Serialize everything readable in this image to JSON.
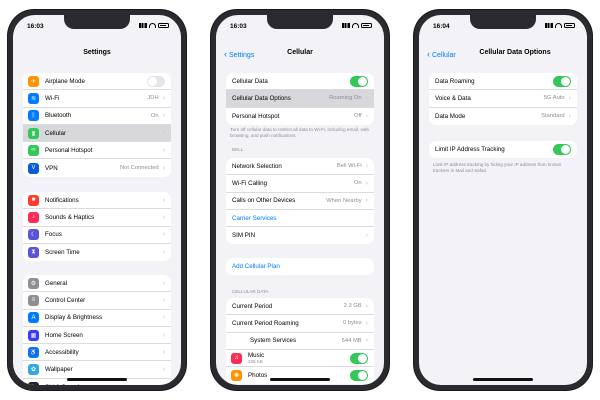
{
  "phone1": {
    "time": "16:03",
    "title": "Settings",
    "group1": [
      {
        "label": "Airplane Mode",
        "value": "",
        "icon": "airplane-icon",
        "color": "#ff9500",
        "toggle": "off"
      },
      {
        "label": "Wi-Fi",
        "value": "JDH",
        "icon": "wifi-icon",
        "color": "#007aff"
      },
      {
        "label": "Bluetooth",
        "value": "On",
        "icon": "bluetooth-icon",
        "color": "#007aff"
      },
      {
        "label": "Cellular",
        "value": "",
        "icon": "cellular-icon",
        "color": "#34c759",
        "selected": true
      },
      {
        "label": "Personal Hotspot",
        "value": "",
        "icon": "hotspot-icon",
        "color": "#34c759"
      },
      {
        "label": "VPN",
        "value": "Not Connected",
        "icon": "vpn-icon",
        "color": "#0a5bd6"
      }
    ],
    "group2": [
      {
        "label": "Notifications",
        "icon": "notifications-icon",
        "color": "#ff3b30"
      },
      {
        "label": "Sounds & Haptics",
        "icon": "sounds-icon",
        "color": "#ff2d55"
      },
      {
        "label": "Focus",
        "icon": "focus-icon",
        "color": "#5856d6"
      },
      {
        "label": "Screen Time",
        "icon": "screen-time-icon",
        "color": "#5856d6"
      }
    ],
    "group3": [
      {
        "label": "General",
        "icon": "general-icon",
        "color": "#8e8e93"
      },
      {
        "label": "Control Center",
        "icon": "control-center-icon",
        "color": "#8e8e93"
      },
      {
        "label": "Display & Brightness",
        "icon": "display-icon",
        "color": "#007aff"
      },
      {
        "label": "Home Screen",
        "icon": "home-screen-icon",
        "color": "#3a3aff"
      },
      {
        "label": "Accessibility",
        "icon": "accessibility-icon",
        "color": "#007aff"
      },
      {
        "label": "Wallpaper",
        "icon": "wallpaper-icon",
        "color": "#34aadc"
      },
      {
        "label": "Siri & Search",
        "icon": "siri-icon",
        "color": "#222222"
      }
    ]
  },
  "phone2": {
    "time": "16:03",
    "back": "Settings",
    "title": "Cellular",
    "group1": [
      {
        "label": "Cellular Data",
        "toggle": "on"
      },
      {
        "label": "Cellular Data Options",
        "value": "Roaming On",
        "selected": true
      },
      {
        "label": "Personal Hotspot",
        "value": "Off"
      }
    ],
    "note1": "Turn off cellular data to restrict all data to Wi-Fi, including email, web browsing, and push notifications.",
    "section_bell": "BELL",
    "group2": [
      {
        "label": "Network Selection",
        "value": "Bell Wi-Fi"
      },
      {
        "label": "Wi-Fi Calling",
        "value": "On"
      },
      {
        "label": "Calls on Other Devices",
        "value": "When Nearby"
      },
      {
        "label": "Carrier Services",
        "blue": true
      },
      {
        "label": "SIM PIN"
      }
    ],
    "add_plan": "Add Cellular Plan",
    "section_data": "CELLULAR DATA",
    "group3": [
      {
        "label": "Current Period",
        "value": "2.3 GB"
      },
      {
        "label": "Current Period Roaming",
        "value": "0 bytes"
      },
      {
        "label": "System Services",
        "value": "544 MB"
      },
      {
        "label": "Music",
        "sub": "328 KB",
        "toggle": "on"
      },
      {
        "label": "Photos",
        "sub": "",
        "toggle": "on"
      }
    ]
  },
  "phone3": {
    "time": "16:04",
    "back": "Cellular",
    "title": "Cellular Data Options",
    "group1": [
      {
        "label": "Data Roaming",
        "toggle": "on"
      },
      {
        "label": "Voice & Data",
        "value": "5G Auto"
      },
      {
        "label": "Data Mode",
        "value": "Standard"
      }
    ],
    "group2": [
      {
        "label": "Limit IP Address Tracking",
        "toggle": "on"
      }
    ],
    "note2": "Limit IP address tracking by hiding your IP address from known trackers in Mail and Safari."
  }
}
